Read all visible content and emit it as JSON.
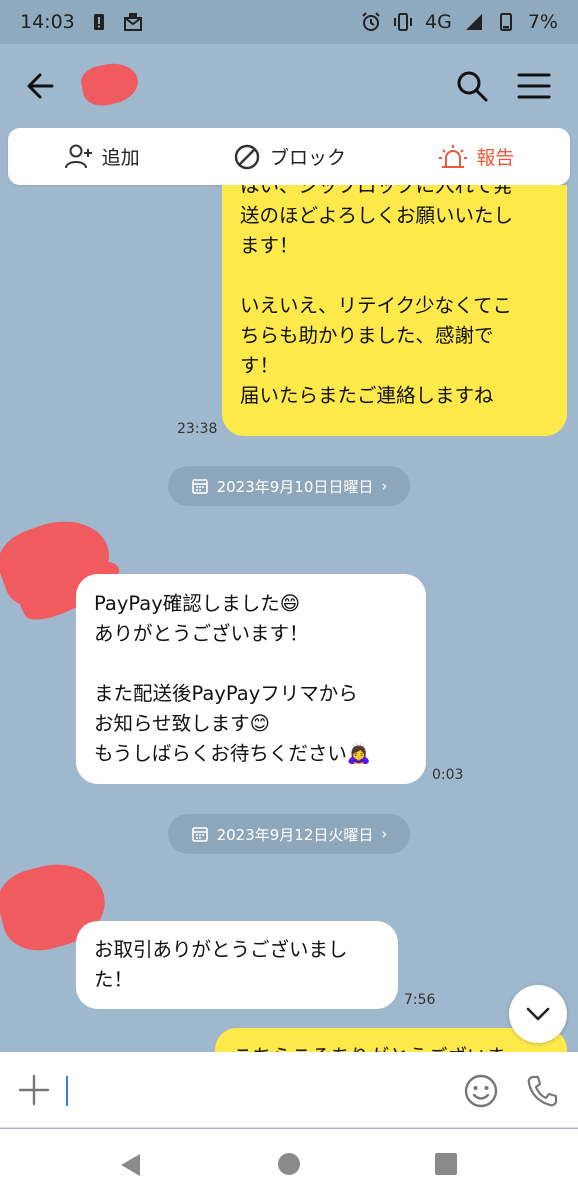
{
  "status_bar": {
    "time": "14:03",
    "network": "4G",
    "battery": "7%",
    "icons": [
      "battery-alert-icon",
      "mail-notification-icon",
      "alarm-icon",
      "vibrate-icon",
      "signal-icon",
      "battery-icon"
    ]
  },
  "header": {
    "icons": [
      "back-arrow-icon",
      "search-icon",
      "hamburger-menu-icon"
    ]
  },
  "action_bar": {
    "add_label": "追加",
    "block_label": "ブロック",
    "report_label": "報告",
    "report_color": "#e85a3a"
  },
  "messages": [
    {
      "sender": "me",
      "lines_a": [
        "はい、ジップロックに入れて発",
        "送のほどよろしくお願いいたし",
        "ます！"
      ],
      "lines_b": [
        "いえいえ、リテイク少なくてこ",
        "ちらも助かりました、感謝で",
        "す！",
        "届いたらまたご連絡しますね"
      ],
      "time": "23:38"
    },
    {
      "date_chip": "2023年9月10日日曜日"
    },
    {
      "sender": "them",
      "lines_a": [
        "PayPay確認しました😄",
        "ありがとうございます！"
      ],
      "lines_b": [
        "また配送後PayPayフリマから",
        "お知らせ致します😊",
        "もうしばらくお待ちください🙇‍♀️"
      ],
      "time": "0:03"
    },
    {
      "date_chip": "2023年9月12日火曜日"
    },
    {
      "sender": "them",
      "lines_a": [
        "お取引ありがとうございまし",
        "た！"
      ],
      "time": "7:56"
    },
    {
      "sender": "me",
      "lines_a": [
        "こちらこそありがとうございま"
      ]
    }
  ],
  "colors": {
    "chat_bg": "#9fb8cd",
    "my_bubble": "#fde94a",
    "their_bubble": "#ffffff",
    "redaction": "#ef5b5e"
  },
  "input": {
    "value": "",
    "placeholder": ""
  }
}
